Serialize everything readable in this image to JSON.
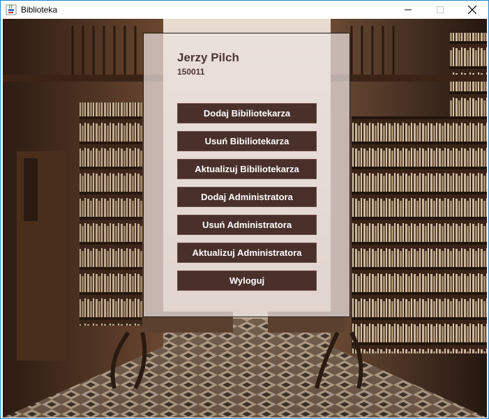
{
  "window": {
    "title": "Biblioteka",
    "icons": {
      "app": "java-cup-icon",
      "minimize": "minimize-icon",
      "maximize": "maximize-icon",
      "close": "close-icon"
    }
  },
  "user": {
    "name": "Jerzy Pilch",
    "id": "150011"
  },
  "menu": {
    "buttons": [
      {
        "label": "Dodaj Bibiliotekarza"
      },
      {
        "label": "Usuń Bibiliotekarza"
      },
      {
        "label": "Aktualizuj Bibiliotekarza"
      },
      {
        "label": "Dodaj Administratora"
      },
      {
        "label": "Usuń Administratora"
      },
      {
        "label": "Aktualizuj Administratora"
      },
      {
        "label": "Wyloguj"
      }
    ]
  },
  "colors": {
    "button_bg": "#4a302b",
    "button_text": "#ffffff",
    "panel_bg": "#ece2e0",
    "heading_text": "#4a3633"
  }
}
